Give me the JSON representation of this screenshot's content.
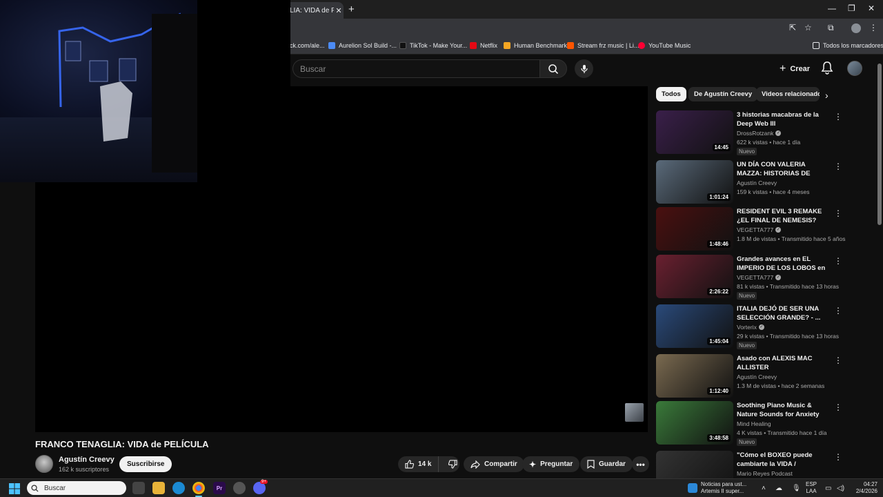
{
  "browser": {
    "tab_title": "LIA: VIDA de PEL",
    "tab_close": "✕",
    "new_tab": "+",
    "bookmarks": [
      {
        "label": "ck.com/ale...",
        "color": "#5f6368"
      },
      {
        "label": "Aurelion Sol Build -...",
        "color": "#4c8bf5"
      },
      {
        "label": "TikTok - Make Your...",
        "color": "#111111"
      },
      {
        "label": "Netflix",
        "color": "#e50914"
      },
      {
        "label": "Human Benchmark",
        "color": "#f5a623"
      },
      {
        "label": "Stream frz music | Li...",
        "color": "#ff5500"
      },
      {
        "label": "YouTube Music",
        "color": "#ff0033"
      }
    ],
    "all_bookmarks": "Todos los marcadores"
  },
  "header": {
    "search_placeholder": "Buscar",
    "create_label": "Crear"
  },
  "video": {
    "title": "FRANCO TENAGLIA: VIDA de PELÍCULA",
    "channel": "Agustín Creevy",
    "subscribers": "162 k suscriptores",
    "subscribe_label": "Suscribirse",
    "likes": "14 k",
    "share_label": "Compartir",
    "ask_label": "Preguntar",
    "save_label": "Guardar"
  },
  "chips": [
    "Todos",
    "De Agustín Creevy",
    "Videos relacionados"
  ],
  "recommendations": [
    {
      "title": "3 historias macabras de la Deep Web III",
      "channel": "DrossRotzank",
      "verified": true,
      "meta": "622 k vistas • hace 1 día",
      "badge": "Nuevo",
      "duration": "14:45",
      "thumb": "#3a1f4a"
    },
    {
      "title": "UN DÍA CON VALERIA MAZZA: HISTORIAS DE SUPERMODEL...",
      "channel": "Agustín Creevy",
      "verified": false,
      "meta": "159 k vistas • hace 4 meses",
      "badge": "",
      "duration": "1:01:24",
      "thumb": "#5a6a7a"
    },
    {
      "title": "RESIDENT EVIL 3 REMAKE ¿EL FINAL DE NEMESIS?",
      "channel": "VEGETTA777",
      "verified": true,
      "meta": "1.8 M de vistas • Transmitido hace 5 años",
      "badge": "",
      "duration": "1:48:46",
      "thumb": "#4a1010"
    },
    {
      "title": "Grandes avances en EL IMPERIO DE LOS LOBOS en ...",
      "channel": "VEGETTA777",
      "verified": true,
      "meta": "81 k vistas • Transmitido hace 13 horas",
      "badge": "Nuevo",
      "duration": "2:26:22",
      "thumb": "#6a2030"
    },
    {
      "title": "ITALIA DEJÓ DE SER UNA SELECCIÓN GRANDE? - ...",
      "channel": "Vorterix",
      "verified": true,
      "meta": "29 k vistas • Transmitido hace 13 horas",
      "badge": "Nuevo",
      "duration": "1:45:04",
      "thumb": "#2a4a7a"
    },
    {
      "title": "Asado con ALEXIS MAC ALLISTER",
      "channel": "Agustín Creevy",
      "verified": false,
      "meta": "1.3 M de vistas • hace 2 semanas",
      "badge": "",
      "duration": "1:12:40",
      "thumb": "#7a6a50"
    },
    {
      "title": "Soothing Piano Music & Nature Sounds for Anxiety Relief, ...",
      "channel": "Mind Healing",
      "verified": false,
      "meta": "4 K vistas • Transmitido hace 1 día",
      "badge": "Nuevo",
      "duration": "3:48:58",
      "thumb": "#3a7a3a"
    },
    {
      "title": "\"Cómo el BOXEO puede cambiarte la VIDA / Entrenado...",
      "channel": "Mario Reyes Podcast",
      "verified": false,
      "meta": "",
      "badge": "",
      "duration": "",
      "thumb": "#333333"
    }
  ],
  "taskbar": {
    "search_placeholder": "Buscar",
    "news_title": "Noticias para ust...",
    "news_sub": "Artemis II super...",
    "lang_top": "ESP",
    "lang_bottom": "LAA",
    "time": "04:27",
    "date": "2/4/2026",
    "notif_count": "9+"
  }
}
